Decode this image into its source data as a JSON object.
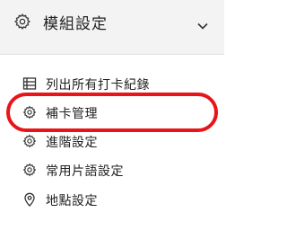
{
  "section": {
    "title": "模組設定",
    "icon": "gear-icon",
    "expand_icon": "chevron-down-icon"
  },
  "menu": [
    {
      "label": "列出所有打卡紀錄",
      "icon": "list-icon"
    },
    {
      "label": "補卡管理",
      "icon": "gear-icon"
    },
    {
      "label": "進階設定",
      "icon": "gear-icon"
    },
    {
      "label": "常用片語設定",
      "icon": "gear-icon"
    },
    {
      "label": "地點設定",
      "icon": "location-pin-icon"
    }
  ],
  "highlight": {
    "target": "補卡管理",
    "color": "#e8141a"
  }
}
